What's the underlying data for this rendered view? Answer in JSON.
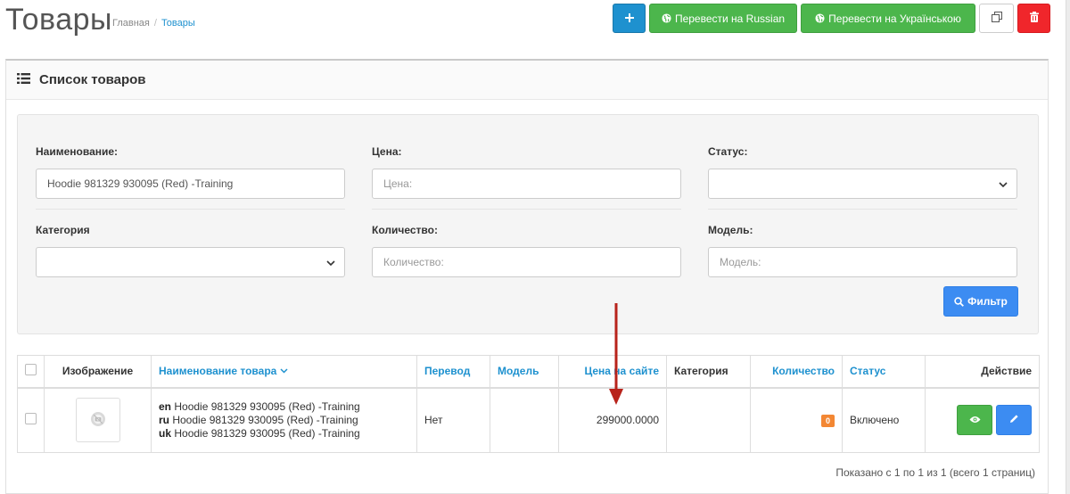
{
  "header": {
    "title": "Товары",
    "breadcrumb": [
      "Главная",
      "Товары"
    ]
  },
  "actions": {
    "add": "",
    "translate_ru": "Перевести на Russian",
    "translate_uk": "Перевести на Українською",
    "copy": "",
    "delete": ""
  },
  "panel": {
    "title": "Список товаров"
  },
  "filter": {
    "name_label": "Наименование:",
    "name_value": "Hoodie 981329 930095 (Red) -Training",
    "price_label": "Цена:",
    "price_placeholder": "Цена:",
    "status_label": "Статус:",
    "status_value": "",
    "category_label": "Категория",
    "category_value": "",
    "quantity_label": "Количество:",
    "quantity_placeholder": "Количество:",
    "model_label": "Модель:",
    "model_placeholder": "Модель:",
    "button": "Фильтр"
  },
  "table": {
    "columns": {
      "image": "Изображение",
      "name": "Наименование товара",
      "translation": "Перевод",
      "model": "Модель",
      "price": "Цена на сайте",
      "category": "Категория",
      "quantity": "Количество",
      "status": "Статус",
      "action": "Действие"
    },
    "rows": [
      {
        "names": [
          {
            "lang": "en",
            "text": "Hoodie 981329 930095 (Red) -Training"
          },
          {
            "lang": "ru",
            "text": "Hoodie 981329 930095 (Red) -Training"
          },
          {
            "lang": "uk",
            "text": "Hoodie 981329 930095 (Red) -Training"
          }
        ],
        "translation": "Нет",
        "model": "",
        "price": "299000.0000",
        "category": "",
        "quantity": "0",
        "status": "Включено"
      }
    ]
  },
  "pagination": {
    "text": "Показано с 1 по 1 из 1 (всего 1 страниц)"
  },
  "colors": {
    "blue": "#1e91cf",
    "primary": "#3c8cf2",
    "green": "#4cb64c",
    "red": "#f0262b",
    "orange": "#f38733",
    "arrow": "#b8231b"
  },
  "icons": [
    "plus-icon",
    "globe-icon",
    "copy-icon",
    "trash-icon",
    "list-icon",
    "search-icon",
    "chevron-down-icon",
    "no-image-icon",
    "eye-icon",
    "pencil-icon",
    "sort-chevron-icon"
  ]
}
